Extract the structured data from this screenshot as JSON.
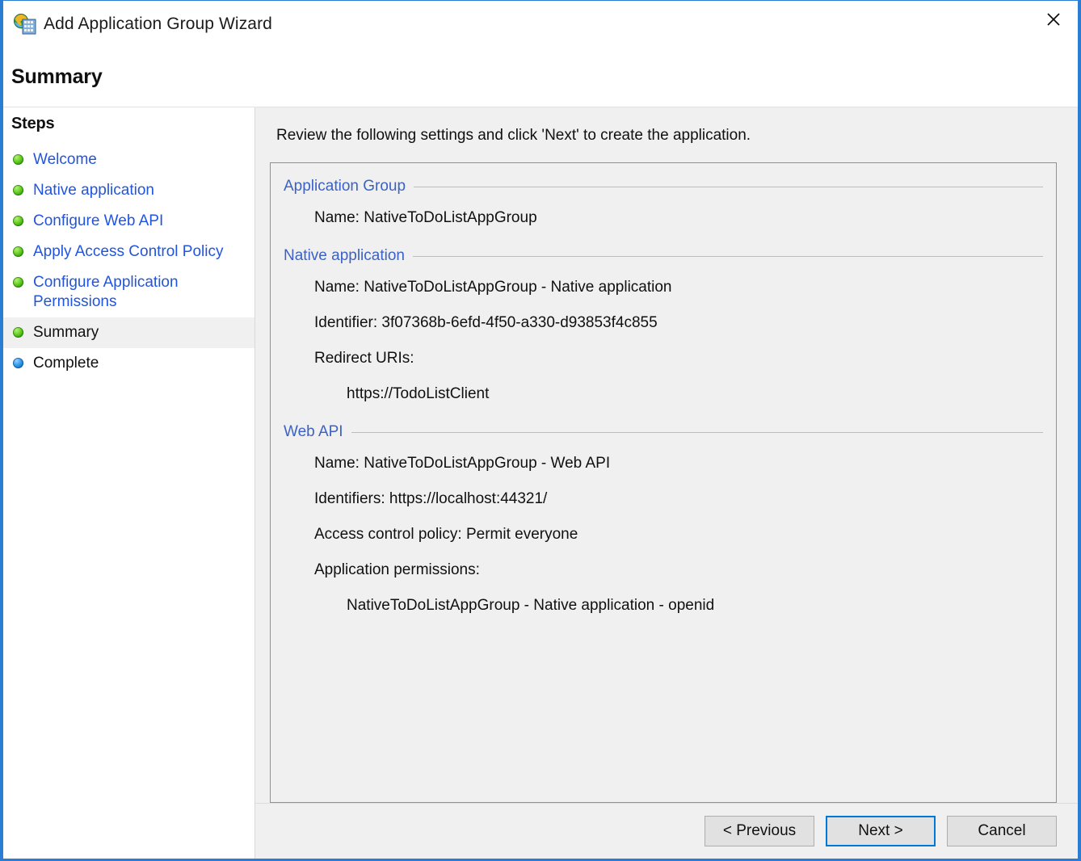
{
  "window": {
    "title": "Add Application Group Wizard",
    "icon": "app-group-wizard-icon",
    "close_label": "✕",
    "accent_color": "#2b7cd3"
  },
  "page": {
    "title": "Summary",
    "intro": "Review the following settings and click 'Next' to create the application."
  },
  "sidebar": {
    "heading": "Steps",
    "items": [
      {
        "label": "Welcome",
        "state": "done",
        "bullet": "green"
      },
      {
        "label": "Native application",
        "state": "done",
        "bullet": "green"
      },
      {
        "label": "Configure Web API",
        "state": "done",
        "bullet": "green"
      },
      {
        "label": "Apply Access Control Policy",
        "state": "done",
        "bullet": "green"
      },
      {
        "label": "Configure Application Permissions",
        "state": "done",
        "bullet": "green"
      },
      {
        "label": "Summary",
        "state": "current",
        "bullet": "green"
      },
      {
        "label": "Complete",
        "state": "pending",
        "bullet": "blue"
      }
    ]
  },
  "summary": {
    "sections": [
      {
        "title": "Application Group",
        "lines": [
          {
            "text": "Name: NativeToDoListAppGroup",
            "indent": 0
          }
        ]
      },
      {
        "title": "Native application",
        "lines": [
          {
            "text": "Name: NativeToDoListAppGroup - Native application",
            "indent": 0
          },
          {
            "text": "Identifier: 3f07368b-6efd-4f50-a330-d93853f4c855",
            "indent": 0
          },
          {
            "text": "Redirect URIs:",
            "indent": 0
          },
          {
            "text": "https://TodoListClient",
            "indent": 1
          }
        ]
      },
      {
        "title": "Web API",
        "lines": [
          {
            "text": "Name: NativeToDoListAppGroup - Web API",
            "indent": 0
          },
          {
            "text": "Identifiers: https://localhost:44321/",
            "indent": 0
          },
          {
            "text": "Access control policy: Permit everyone",
            "indent": 0
          },
          {
            "text": "Application permissions:",
            "indent": 0
          },
          {
            "text": "NativeToDoListAppGroup - Native application - openid",
            "indent": 1
          }
        ]
      }
    ]
  },
  "footer": {
    "buttons": [
      {
        "label": "< Previous",
        "name": "previous-button",
        "default": false
      },
      {
        "label": "Next >",
        "name": "next-button",
        "default": true
      },
      {
        "label": "Cancel",
        "name": "cancel-button",
        "default": false
      }
    ]
  },
  "colors": {
    "link": "#2255dd",
    "section_heading": "#3b62c4",
    "focus_border": "#0078d7",
    "panel_bg": "#f0f0f0"
  }
}
